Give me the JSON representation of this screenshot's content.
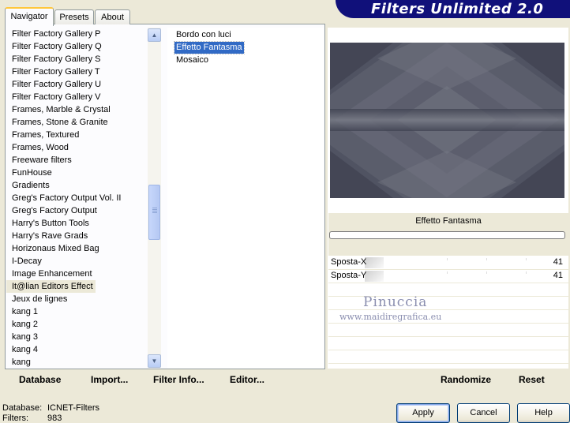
{
  "tabs": [
    {
      "label": "Navigator",
      "active": true
    },
    {
      "label": "Presets",
      "active": false
    },
    {
      "label": "About",
      "active": false
    }
  ],
  "banner": {
    "title": "Filters Unlimited 2.0"
  },
  "categories": [
    "Filter Factory Gallery P",
    "Filter Factory Gallery Q",
    "Filter Factory Gallery S",
    "Filter Factory Gallery T",
    "Filter Factory Gallery U",
    "Filter Factory Gallery V",
    "Frames, Marble & Crystal",
    "Frames, Stone & Granite",
    "Frames, Textured",
    "Frames, Wood",
    "Freeware filters",
    "FunHouse",
    "Gradients",
    "Greg's Factory Output Vol. II",
    "Greg's Factory Output",
    "Harry's Button Tools",
    "Harry's Rave Grads",
    "Horizonaus Mixed Bag",
    "I-Decay",
    "Image Enhancement",
    "It@lian Editors Effect",
    "Jeux de lignes",
    "kang 1",
    "kang 2",
    "kang 3",
    "kang 4",
    "kang"
  ],
  "selected_category": "It@lian Editors Effect",
  "filters": [
    "Bordo con luci",
    "Effetto Fantasma",
    "Mosaico"
  ],
  "selected_filter": "Effetto Fantasma",
  "effect_name": "Effetto Fantasma",
  "sliders": [
    {
      "label": "Sposta-X",
      "value": "41"
    },
    {
      "label": "Sposta-Y",
      "value": "41"
    }
  ],
  "watermark": {
    "name": "Pinuccia",
    "url": "www.maidiregrafica.eu"
  },
  "bottom_buttons": {
    "database": "Database",
    "import": "Import...",
    "filter_info": "Filter Info...",
    "editor": "Editor...",
    "randomize": "Randomize",
    "reset": "Reset"
  },
  "status": {
    "database_label": "Database:",
    "database_value": "ICNET-Filters",
    "filters_label": "Filters:",
    "filters_value": "983"
  },
  "dialog_buttons": {
    "apply": "Apply",
    "cancel": "Cancel",
    "help": "Help"
  },
  "colors": {
    "banner": "#10107a",
    "selection": "#316ac5",
    "window_bg": "#ece9d8"
  }
}
